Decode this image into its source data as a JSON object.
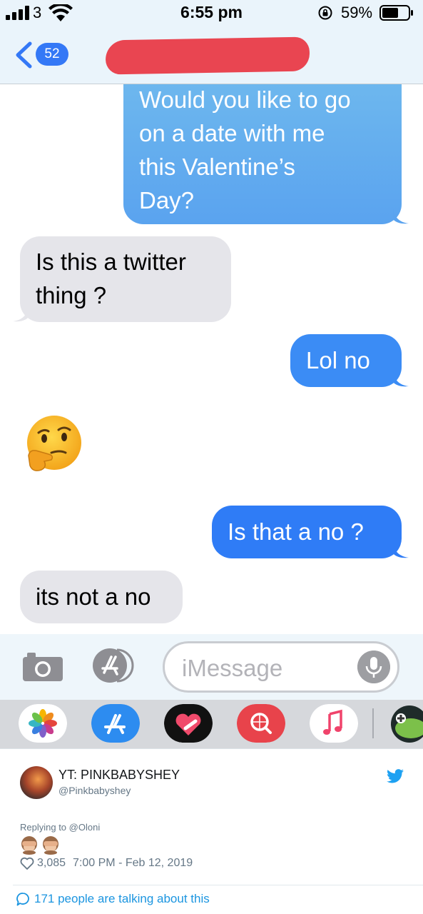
{
  "status_bar": {
    "carrier": "3",
    "time": "6:55 pm",
    "battery": "59%"
  },
  "nav": {
    "back_count": "52"
  },
  "messages": [
    {
      "side": "sent",
      "text": "Would you like to go on a date with me this Valentine’s Day?"
    },
    {
      "side": "received",
      "text": "Is this a twitter thing ?"
    },
    {
      "side": "sent",
      "text": "Lol no"
    },
    {
      "side": "received",
      "emoji": "thinking-face"
    },
    {
      "side": "sent",
      "text": "Is that a no ?"
    },
    {
      "side": "received",
      "text": "its not a no"
    }
  ],
  "msg1": {
    "lines": [
      "Would you like to go",
      "on a date with me",
      "this Valentine’s",
      "Day?"
    ]
  },
  "msg2": {
    "lines": [
      "Is this a twitter",
      "thing ?"
    ]
  },
  "msg3": {
    "text": "Lol no"
  },
  "msg4": {
    "text": "Is that a no ?"
  },
  "msg5": {
    "text": "its not a no"
  },
  "compose": {
    "placeholder": "iMessage"
  },
  "app_drawer": {
    "apps": [
      "photos-icon",
      "app-store-icon",
      "digital-touch-icon",
      "images-search-icon",
      "music-icon",
      "game-icon"
    ]
  },
  "tweet": {
    "display_name": "YT: PINKBABYSHEY",
    "handle": "@Pinkbabyshey",
    "replying_prefix": "Replying to",
    "replying_to": "@Oloni",
    "emoji": "see-no-evil-monkey x2",
    "likes": "3,085",
    "timestamp": "7:00 PM - Feb 12, 2019",
    "talking": "171 people are talking about this"
  },
  "colors": {
    "sent_bubble": "#3b8cf5",
    "received_bubble": "#e5e5ea",
    "twitter_blue": "#1da1f2",
    "redaction": "#e94551"
  }
}
